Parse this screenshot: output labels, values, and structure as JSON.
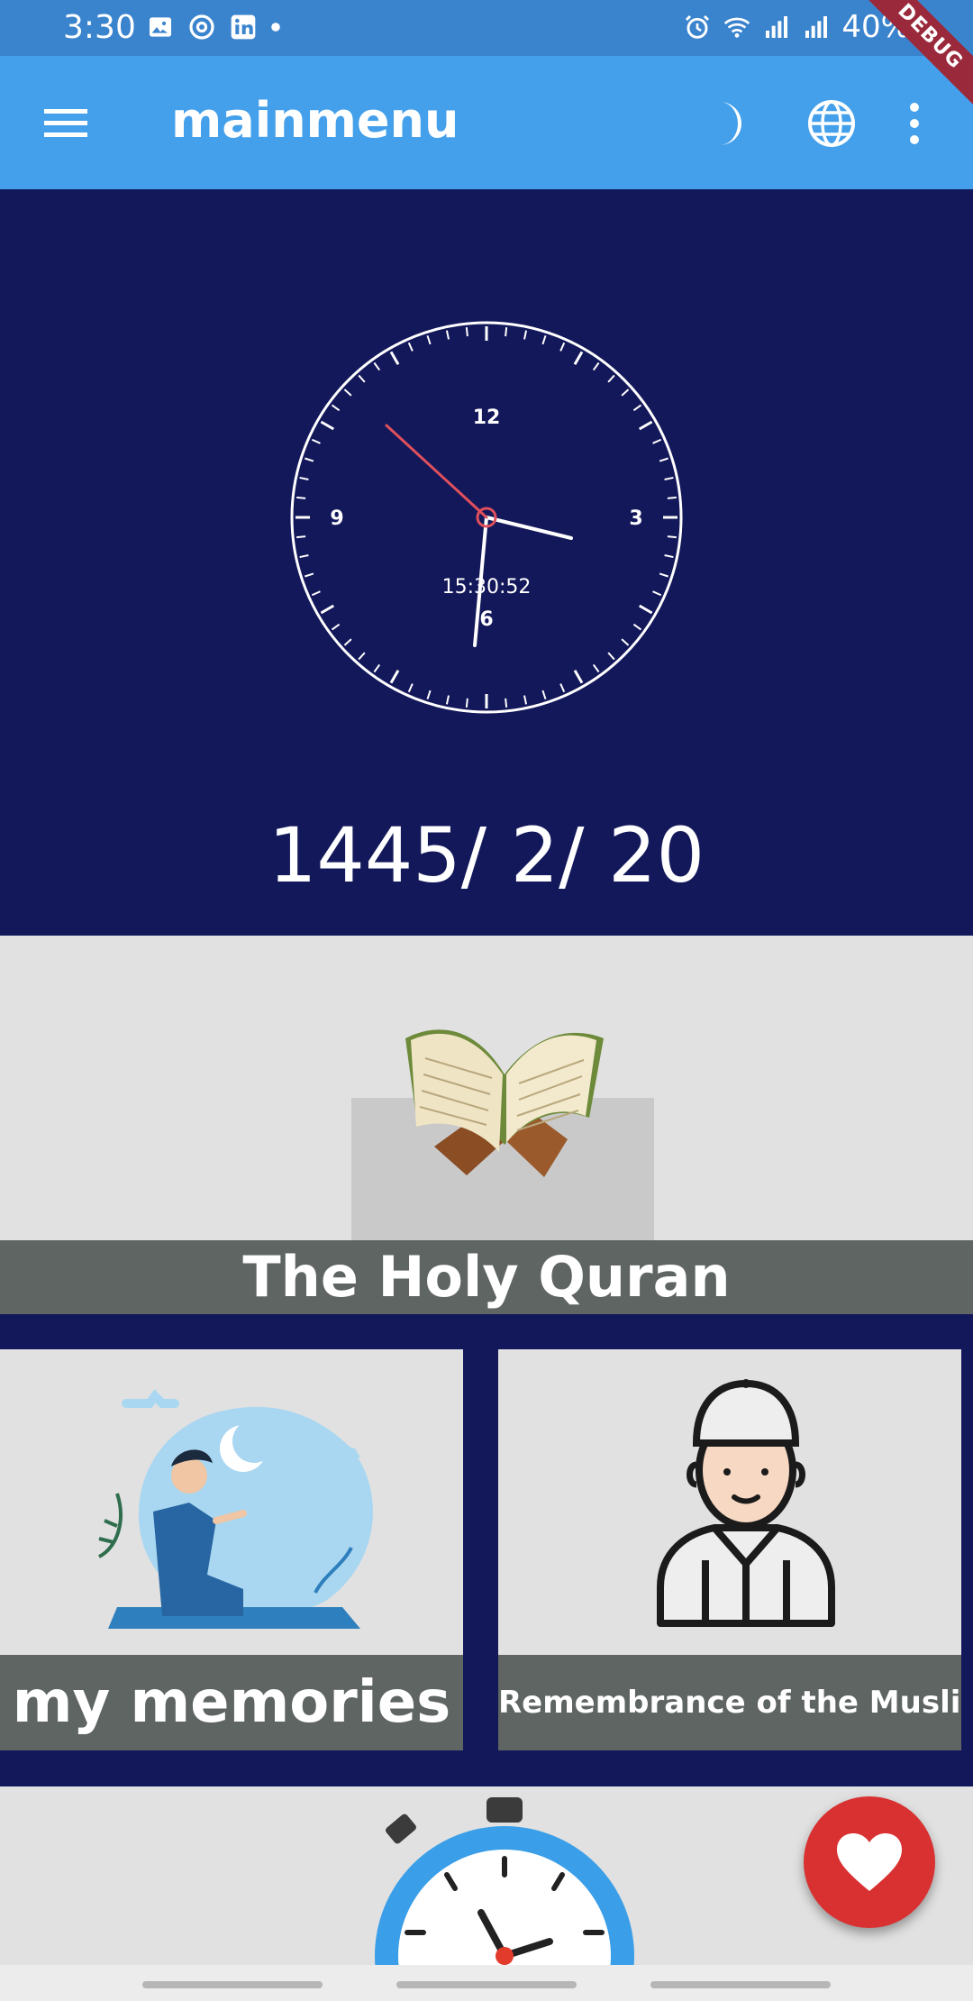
{
  "status_bar": {
    "time": "3:30",
    "battery": "40%",
    "debug": "DEBUG"
  },
  "app_bar": {
    "title": "mainmenu"
  },
  "clock": {
    "digital": "15:30:52",
    "numerals": {
      "twelve": "12",
      "three": "3",
      "six": "6",
      "nine": "9"
    }
  },
  "date": "1445/ 2/ 20",
  "cards": {
    "quran": "The Holy Quran",
    "memories": "my memories",
    "remembrance": "Remembrance of the Muslim"
  },
  "colors": {
    "app_bar": "#44a0ea",
    "status_bar": "#3a83cd",
    "background": "#13185a",
    "card_label": "#5e6563",
    "fab": "#d93131"
  },
  "icons": [
    "menu-icon",
    "moon-icon",
    "globe-icon",
    "more-vert-icon",
    "heart-icon"
  ]
}
